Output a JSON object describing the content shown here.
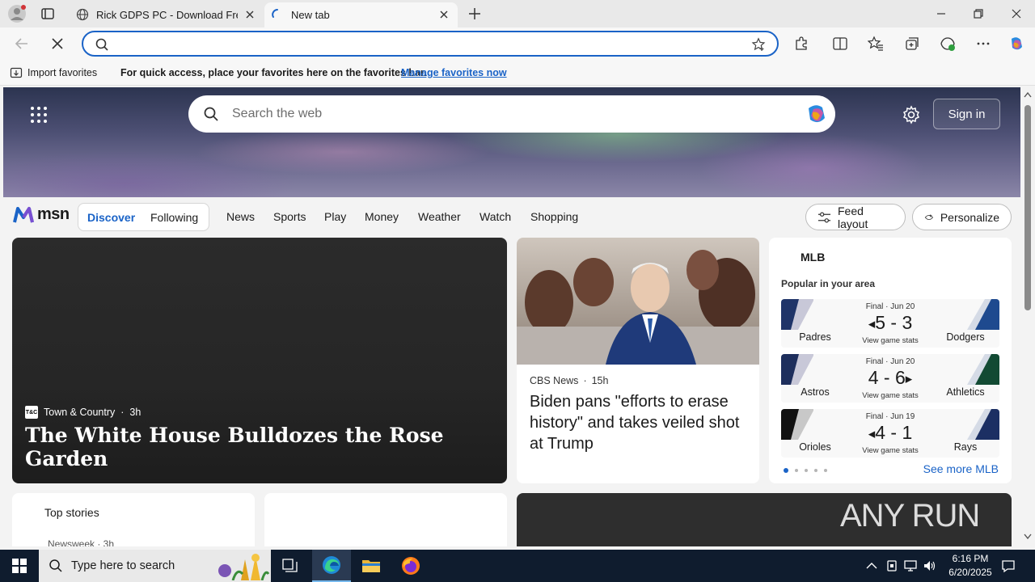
{
  "browser": {
    "tabs": [
      {
        "title": "Rick GDPS PC - Download Free"
      },
      {
        "title": "New tab"
      }
    ],
    "address": {
      "value": "",
      "placeholder": ""
    },
    "favorites_bar": {
      "import_label": "Import favorites",
      "message": "For quick access, place your favorites here on the favorites bar.",
      "link": "Manage favorites now"
    }
  },
  "msn": {
    "search_placeholder": "Search the web",
    "signin_label": "Sign in",
    "logo_text": "msn",
    "pills": [
      "Discover",
      "Following"
    ],
    "nav": [
      "News",
      "Sports",
      "Play",
      "Money",
      "Weather",
      "Watch",
      "Shopping"
    ],
    "feed_layout_label": "Feed layout",
    "personalize_label": "Personalize",
    "hero_story": {
      "source_logo": "T&C",
      "source": "Town & Country",
      "age": "3h",
      "headline": "The White House Bulldozes the Rose Garden"
    },
    "news_story": {
      "source": "CBS News",
      "age": "15h",
      "headline": "Biden pans \"efforts to erase history\" and takes veiled shot at Trump"
    },
    "mlb": {
      "title": "MLB",
      "subtitle": "Popular in your area",
      "games": [
        {
          "status": "Final · Jun 20",
          "score": "5 - 3",
          "winner_arrow": "left",
          "stats": "View game stats",
          "home": "Padres",
          "away": "Dodgers",
          "color_l": "#1f3468",
          "color_r": "#1e4a8f"
        },
        {
          "status": "Final · Jun 20",
          "score": "4 - 6",
          "winner_arrow": "right",
          "stats": "View game stats",
          "home": "Astros",
          "away": "Athletics",
          "color_l": "#1d2e5c",
          "color_r": "#124a33"
        },
        {
          "status": "Final · Jun 19",
          "score": "4 - 1",
          "winner_arrow": "left",
          "stats": "View game stats",
          "home": "Orioles",
          "away": "Rays",
          "color_l": "#111111",
          "color_r": "#1c2f63"
        }
      ],
      "see_more": "See more MLB"
    },
    "top_stories": {
      "title": "Top stories",
      "source": "Newsweek · 3h"
    },
    "watermark": "ANY RUN"
  },
  "taskbar": {
    "search_text": "Type here to search",
    "time": "6:16 PM",
    "date": "6/20/2025"
  },
  "colors": {
    "accent": "#1a63c7",
    "taskbar": "#0f1c2e"
  }
}
